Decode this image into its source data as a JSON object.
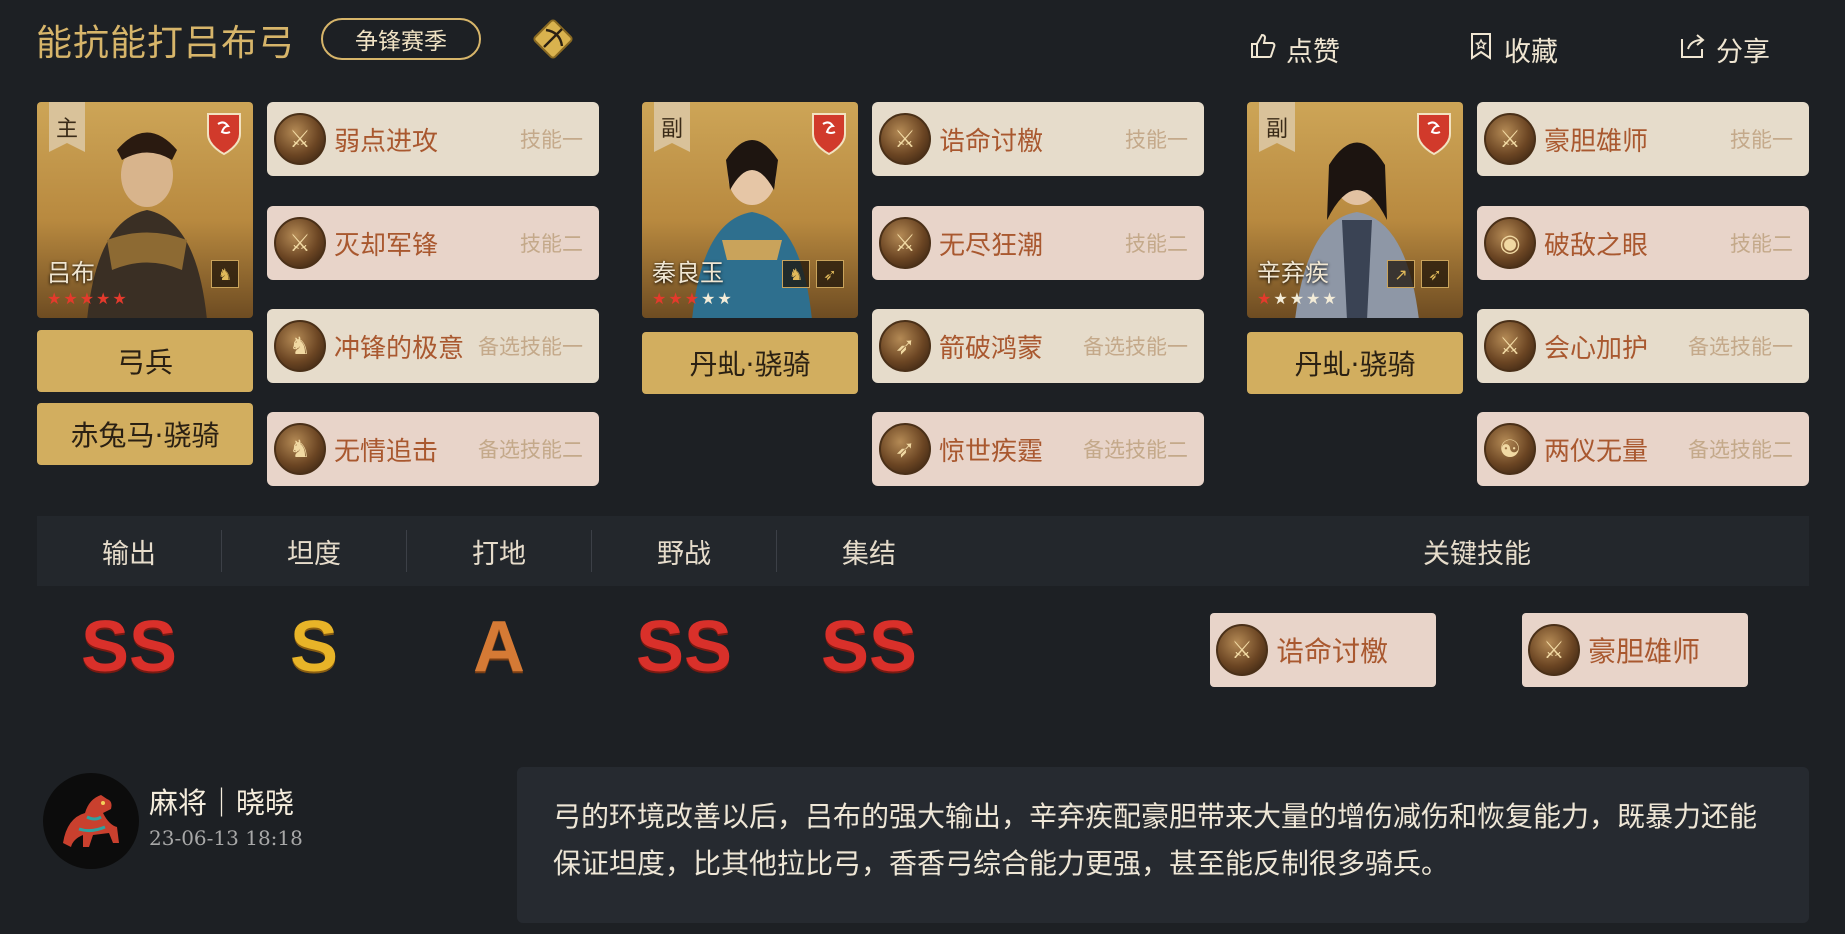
{
  "header": {
    "title": "能抗能打吕布弓",
    "season_label": "争锋赛季",
    "badge_icon": "bow-diamond-icon",
    "actions": {
      "like": "点赞",
      "favorite": "收藏",
      "share": "分享"
    }
  },
  "heroes": [
    {
      "role": "主",
      "name": "吕布",
      "red_stars": 5,
      "white_stars": 0,
      "badge_icons": [
        "horse-icon"
      ],
      "tags": [
        "弓兵",
        "赤兔马·骁骑"
      ],
      "skills": [
        {
          "name": "弱点进攻",
          "slot": "技能一"
        },
        {
          "name": "灭却军锋",
          "slot": "技能二"
        },
        {
          "name": "冲锋的极意",
          "slot": "备选技能一"
        },
        {
          "name": "无情追击",
          "slot": "备选技能二"
        }
      ]
    },
    {
      "role": "副",
      "name": "秦良玉",
      "red_stars": 3,
      "white_stars": 2,
      "badge_icons": [
        "horse-icon",
        "bow-icon"
      ],
      "tags": [
        "丹虬·骁骑"
      ],
      "skills": [
        {
          "name": "诰命讨檄",
          "slot": "技能一"
        },
        {
          "name": "无尽狂潮",
          "slot": "技能二"
        },
        {
          "name": "箭破鸿蒙",
          "slot": "备选技能一"
        },
        {
          "name": "惊世疾霆",
          "slot": "备选技能二"
        }
      ]
    },
    {
      "role": "副",
      "name": "辛弃疾",
      "red_stars": 1,
      "white_stars": 4,
      "badge_icons": [
        "spear-icon",
        "bow-icon"
      ],
      "tags": [
        "丹虬·骁骑"
      ],
      "skills": [
        {
          "name": "豪胆雄师",
          "slot": "技能一"
        },
        {
          "name": "破敌之眼",
          "slot": "技能二"
        },
        {
          "name": "会心加护",
          "slot": "备选技能一"
        },
        {
          "name": "两仪无量",
          "slot": "备选技能二"
        }
      ]
    }
  ],
  "stats": {
    "headers": [
      "输出",
      "坦度",
      "打地",
      "野战",
      "集结"
    ],
    "grades": [
      "SS",
      "S",
      "A",
      "SS",
      "SS"
    ],
    "key_skills_label": "关键技能",
    "key_skills": [
      "诰命讨檄",
      "豪胆雄师"
    ]
  },
  "author": {
    "name": "麻将｜晓晓",
    "date": "23-06-13 18:18",
    "comment": "弓的环境改善以后，吕布的强大输出，辛弃疾配豪胆带来大量的增伤减伤和恢复能力，既暴力还能保证坦度，比其他拉比弓，香香弓综合能力更强，甚至能反制很多骑兵。"
  },
  "colors": {
    "gold": "#d2ae5f",
    "grade_ss": "#d9302a",
    "grade_s": "#e8b428",
    "grade_a": "#d57a35"
  }
}
